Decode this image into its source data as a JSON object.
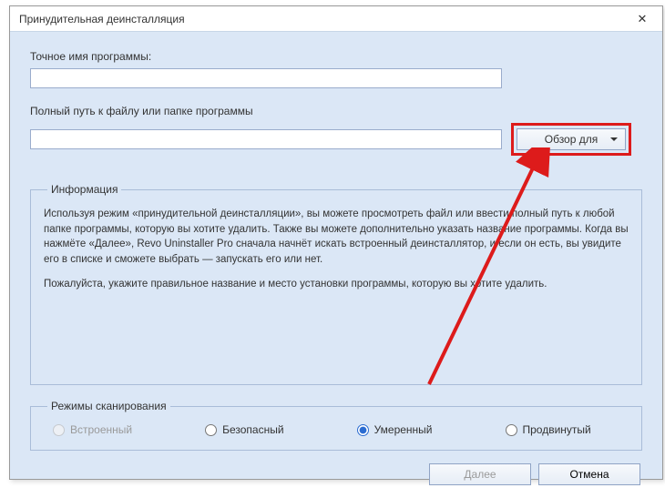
{
  "window": {
    "title": "Принудительная деинсталляция"
  },
  "labels": {
    "program_name": "Точное имя программы:",
    "program_path": "Полный путь к файлу или папке программы"
  },
  "inputs": {
    "program_name_value": "",
    "program_path_value": ""
  },
  "browse": {
    "label": "Обзор для"
  },
  "info": {
    "legend": "Информация",
    "p1": "Используя режим «принудительной деинсталляции», вы можете просмотреть файл или ввести полный путь к любой папке программы, которую вы хотите удалить. Также вы можете дополнительно указать название программы. Когда вы нажмёте «Далее», Revo Uninstaller Pro сначала начнёт искать встроенный деинсталлятор, и если он есть, вы увидите его в списке и сможете выбрать — запускать его или нет.",
    "p2": "Пожалуйста, укажите правильное название и место установки программы, которую вы хотите удалить."
  },
  "scan": {
    "legend": "Режимы сканирования",
    "options": {
      "builtin": "Встроенный",
      "safe": "Безопасный",
      "moderate": "Умеренный",
      "advanced": "Продвинутый"
    },
    "selected": "moderate"
  },
  "footer": {
    "next": "Далее",
    "cancel": "Отмена"
  }
}
